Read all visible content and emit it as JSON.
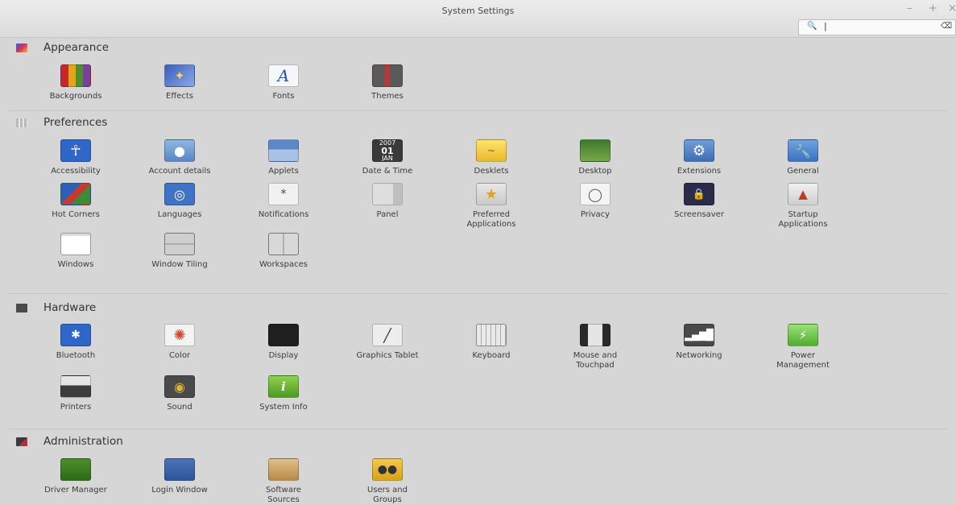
{
  "window": {
    "title": "System Settings",
    "controls": {
      "minimize": "–",
      "maximize": "+",
      "close": "×"
    },
    "search": {
      "mag_icon": "🔍",
      "caret": "|",
      "clear_icon": "⌫"
    }
  },
  "sections": {
    "appearance": {
      "title": "Appearance",
      "items": [
        "Backgrounds",
        "Effects",
        "Fonts",
        "Themes"
      ]
    },
    "preferences": {
      "title": "Preferences",
      "items": [
        "Accessibility",
        "Account details",
        "Applets",
        "Date & Time",
        "Desklets",
        "Desktop",
        "Extensions",
        "General",
        "Hot Corners",
        "Languages",
        "Notifications",
        "Panel",
        "Preferred\nApplications",
        "Privacy",
        "Screensaver",
        "Startup\nApplications",
        "Windows",
        "Window Tiling",
        "Workspaces"
      ]
    },
    "hardware": {
      "title": "Hardware",
      "items": [
        "Bluetooth",
        "Color",
        "Display",
        "Graphics Tablet",
        "Keyboard",
        "Mouse and\nTouchpad",
        "Networking",
        "Power\nManagement",
        "Printers",
        "Sound",
        "System Info"
      ]
    },
    "administration": {
      "title": "Administration",
      "items": [
        "Driver Manager",
        "Login Window",
        "Software\nSources",
        "Users and\nGroups"
      ]
    }
  },
  "icons": {
    "date_time_month": "2007",
    "date_time_day": "01",
    "date_time_sub": "JAN",
    "fonts_glyph": "A",
    "accessibility_glyph": "✱",
    "notifications_glyph": "*",
    "info_glyph": "i",
    "bluetooth_glyph": "✱"
  }
}
